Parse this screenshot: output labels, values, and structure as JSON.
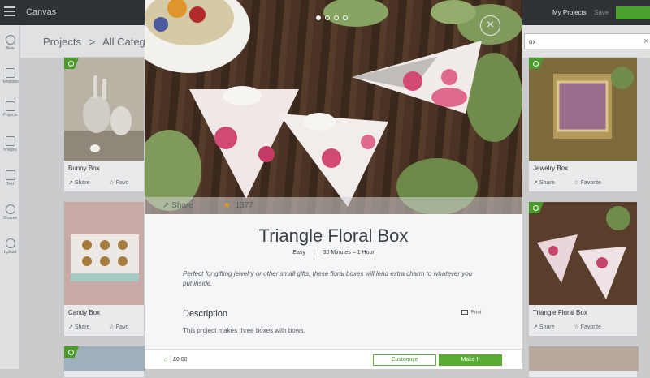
{
  "topbar": {
    "app_title": "Canvas",
    "my_projects": "My Projects",
    "save": "Save"
  },
  "sidebar": {
    "items": [
      {
        "label": "New",
        "icon": "plus-icon"
      },
      {
        "label": "Templates",
        "icon": "shirt-icon"
      },
      {
        "label": "Projects",
        "icon": "projects-icon"
      },
      {
        "label": "Images",
        "icon": "image-icon"
      },
      {
        "label": "Text",
        "icon": "text-icon"
      },
      {
        "label": "Shapes",
        "icon": "shapes-icon"
      },
      {
        "label": "Upload",
        "icon": "upload-icon"
      }
    ]
  },
  "header": {
    "breadcrumb_root": "Projects",
    "breadcrumb_sep": ">",
    "breadcrumb_current": "All Categ",
    "search_value": "ox"
  },
  "cards": {
    "bunny": {
      "title": "Bunny Box"
    },
    "candy": {
      "title": "Candy Box"
    },
    "jewelry": {
      "title": "Jewelry Box"
    },
    "triangle": {
      "title": "Triangle Floral Box"
    },
    "share_label": "Share",
    "favorite_label": "Favorite",
    "favorite_label_cut": "Favo"
  },
  "modal": {
    "share_label": "Share",
    "rating_count": "1377",
    "title": "Triangle Floral Box",
    "difficulty": "Easy",
    "meta_sep": "|",
    "duration": "30 Minutes – 1 Hour",
    "blurb": "Perfect for gifting jewelry or other small gifts, these floral boxes will lend extra charm to whatever you put inside.",
    "description_heading": "Description",
    "print_label": "Print",
    "description_text": "This project makes three boxes with bows.",
    "price": "| £0.00",
    "customize_label": "Customize",
    "make_it_label": "Make It",
    "carousel_total": 4,
    "carousel_active": 1
  },
  "colors": {
    "accent_green": "#59ad33",
    "topbar_bg": "#2f3338",
    "star": "#f19a1a"
  }
}
